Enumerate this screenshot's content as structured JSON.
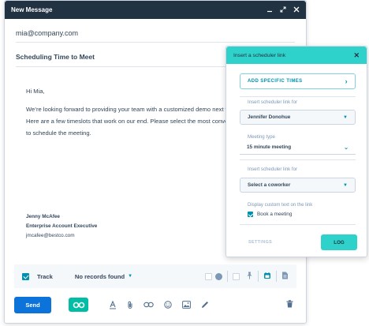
{
  "compose": {
    "title": "New Message",
    "to": "mia@company.com",
    "subject": "Scheduling Time to Meet",
    "greeting": "Hi Mia,",
    "paragraph": "We’re looking forward to providing your team with a customized demo next week. Here are a few timeslots that work on our end. Please select the most convenient time to schedule the meeting.",
    "signature": {
      "name": "Jenny McAfee",
      "role": "Enterprise Account Executive",
      "email": "jmcafee@bestco.com"
    }
  },
  "toolbar": {
    "track_label": "Track",
    "records_label": "No records found"
  },
  "bottom": {
    "send_label": "Send"
  },
  "scheduler": {
    "title": "Insert a scheduler link",
    "add_times_label": "ADD SPECIFIC TIMES",
    "link_for_label": "Insert scheduler link for",
    "link_for_value": "Jennifer Donohue",
    "meeting_type_label": "Meeting type",
    "meeting_type_value": "15 minute meeting",
    "link_for_label_2": "Insert scheduler link for",
    "coworker_value": "Select a coworker",
    "custom_text_label": "Display custom text on the link",
    "custom_text_value": "Book a meeting",
    "settings_label": "SETTINGS",
    "log_label": "LOG"
  },
  "colors": {
    "header_navy": "#213343",
    "teal": "#2fd2cb",
    "send_blue": "#0b73da",
    "accent": "#0091ae"
  }
}
